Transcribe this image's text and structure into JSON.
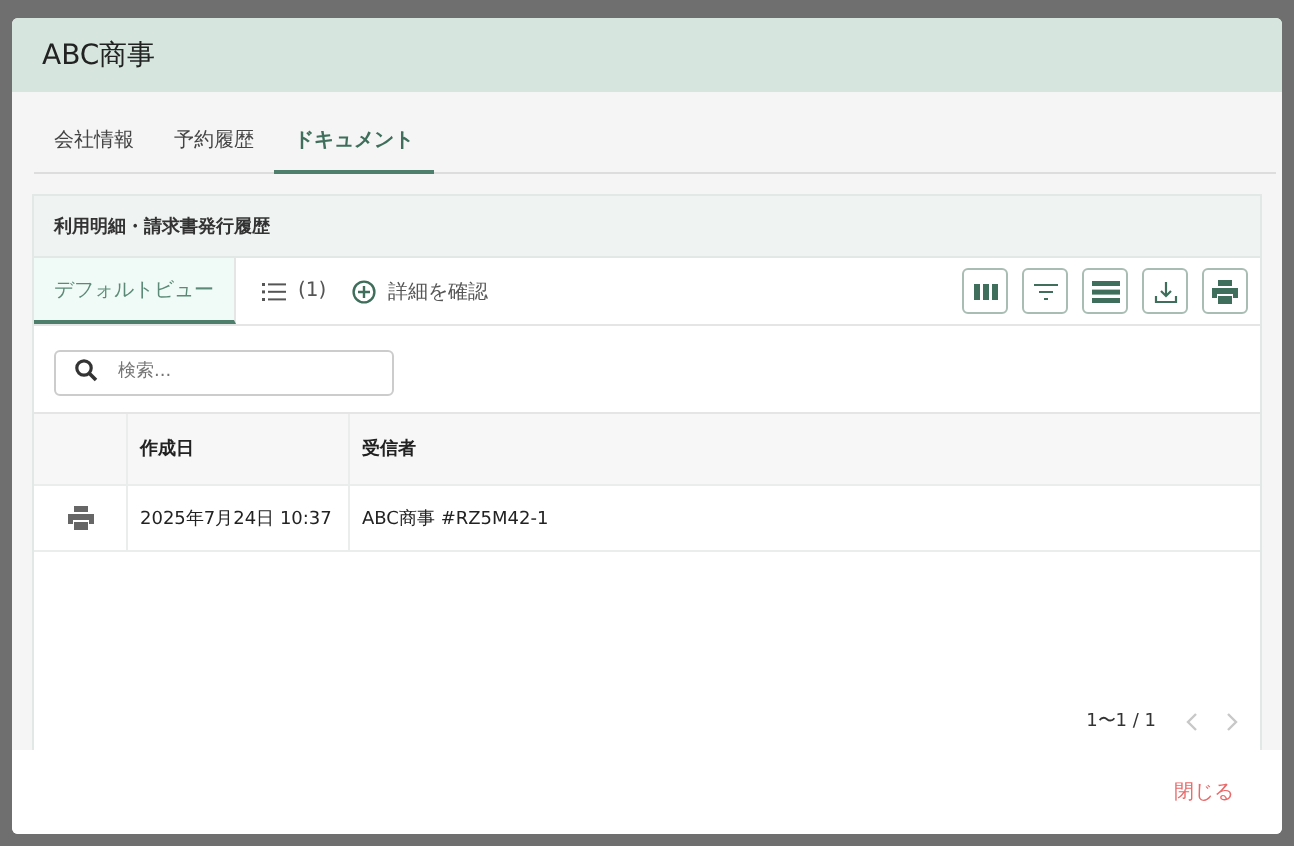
{
  "dialog": {
    "title": "ABC商事"
  },
  "tabs": [
    {
      "label": "会社情報",
      "selected": false
    },
    {
      "label": "予約履歴",
      "selected": false
    },
    {
      "label": "ドキュメント",
      "selected": true
    }
  ],
  "section": {
    "title": "利用明細・請求書発行履歴"
  },
  "view_tabs": [
    {
      "label": "デフォルトビュー",
      "selected": true
    }
  ],
  "filter_count": "(1)",
  "details_button": "詳細を確認",
  "search": {
    "placeholder": "検索..."
  },
  "table": {
    "columns": [
      "作成日",
      "受信者"
    ],
    "rows": [
      {
        "date": "2025年7月24日 10:37",
        "recipient": "ABC商事 #RZ5M42-1"
      }
    ]
  },
  "pagination": {
    "range": "1〜1 / 1",
    "prev_disabled": true,
    "next_disabled": true
  },
  "footer": {
    "close_button": "閉じる"
  }
}
